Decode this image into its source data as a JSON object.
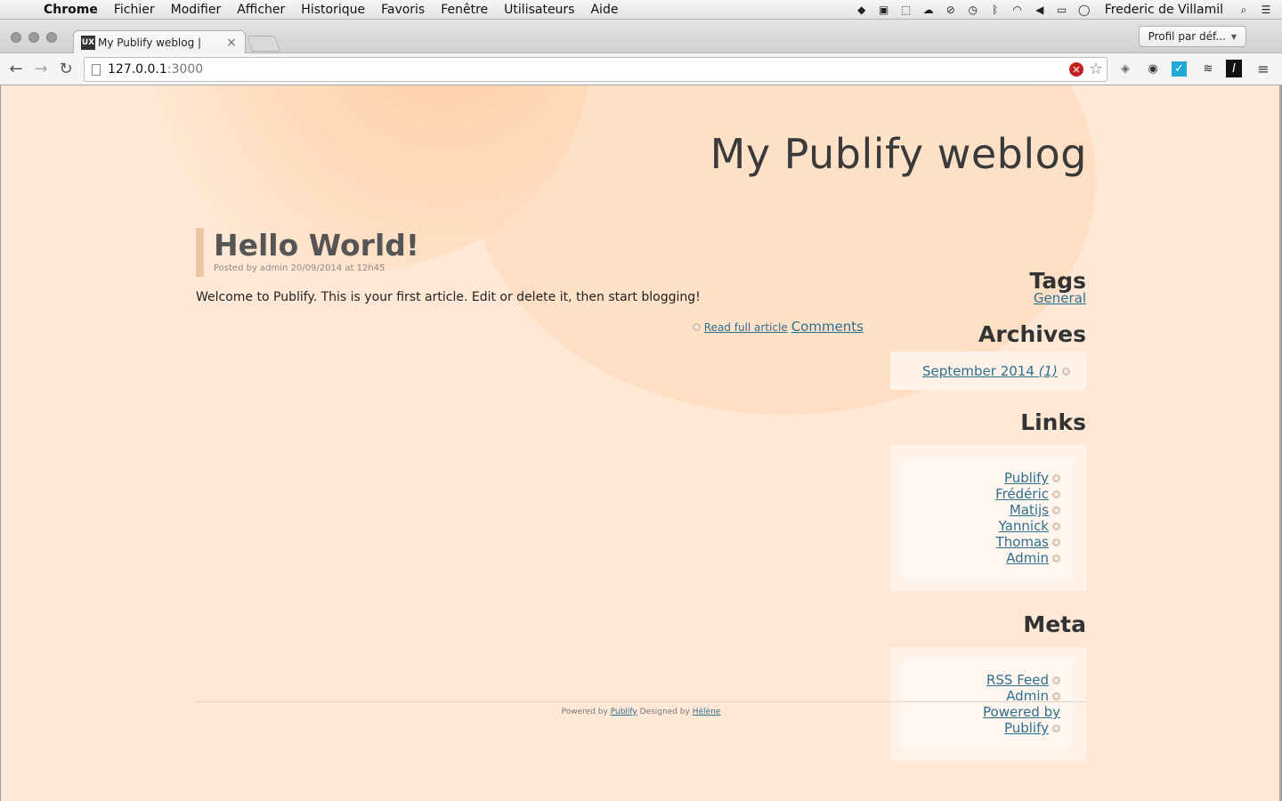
{
  "menubar": {
    "app_name": "Chrome",
    "items": [
      "Fichier",
      "Modifier",
      "Afficher",
      "Historique",
      "Favoris",
      "Fenêtre",
      "Utilisateurs",
      "Aide"
    ],
    "user": "Frederic de Villamil"
  },
  "browser": {
    "tab_title": "My Publify weblog |",
    "favicon_text": "UX",
    "profile_button": "Profil par déf...",
    "url_host": "127.0.0.1",
    "url_port": ":3000"
  },
  "page": {
    "site_title": "My Publify weblog",
    "post": {
      "title": "Hello World!",
      "meta": "Posted by admin 20/09/2014 at 12h45",
      "body": "Welcome to Publify. This is your first article. Edit or delete it, then start blogging!",
      "read_more": "Read full article",
      "comments": "Comments"
    },
    "sidebar": {
      "tags_heading": "Tags",
      "tags": [
        "General"
      ],
      "archives_heading": "Archives",
      "archive_month": "September 2014",
      "archive_count": "(1)",
      "links_heading": "Links",
      "links": [
        "Publify",
        "Frédéric",
        "Matijs",
        "Yannick",
        "Thomas",
        "Admin"
      ],
      "meta_heading": "Meta",
      "meta_rss": "RSS Feed",
      "meta_admin": "Admin",
      "meta_powered_1": "Powered by",
      "meta_powered_2": "Publify"
    },
    "footer": {
      "powered_by": "Powered by",
      "publify": "Publify",
      "designed_by": "Designed by",
      "designer": "Hélène"
    }
  },
  "colors": {
    "page_background": "#ffe9d6",
    "link": "#2f6f8f",
    "title_bar_accent": "#ecc7a5"
  }
}
